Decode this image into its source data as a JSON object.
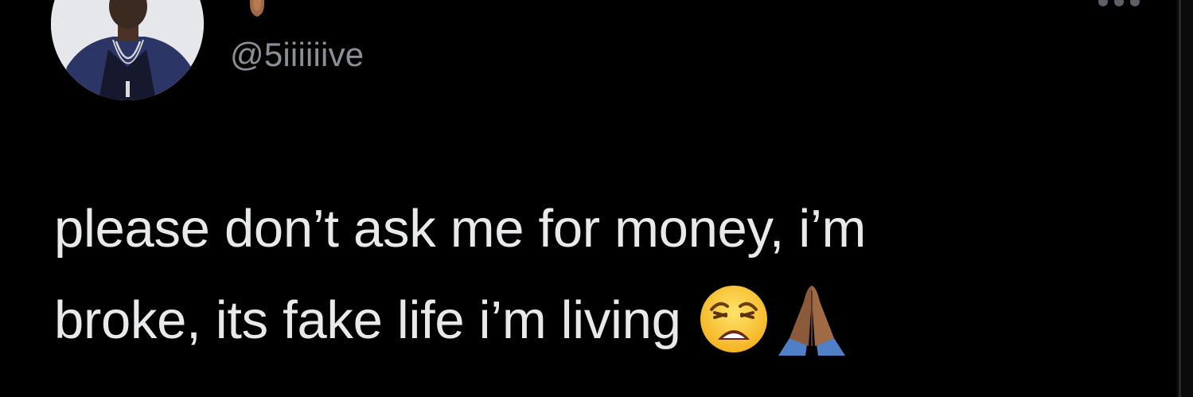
{
  "tweet": {
    "handle": "@5iiiiiive",
    "text_line_1": "please don’t ask me for money, i’m",
    "text_line_2": "broke, its fake life i’m living",
    "emojis": [
      "weary-face-emoji",
      "folded-hands-emoji"
    ]
  },
  "icons": {
    "more": "more-options-icon",
    "name_emoji": "partial-hand-emoji"
  },
  "colors": {
    "background": "#000000",
    "text": "#e7e9ea",
    "handle": "#8b9097"
  }
}
